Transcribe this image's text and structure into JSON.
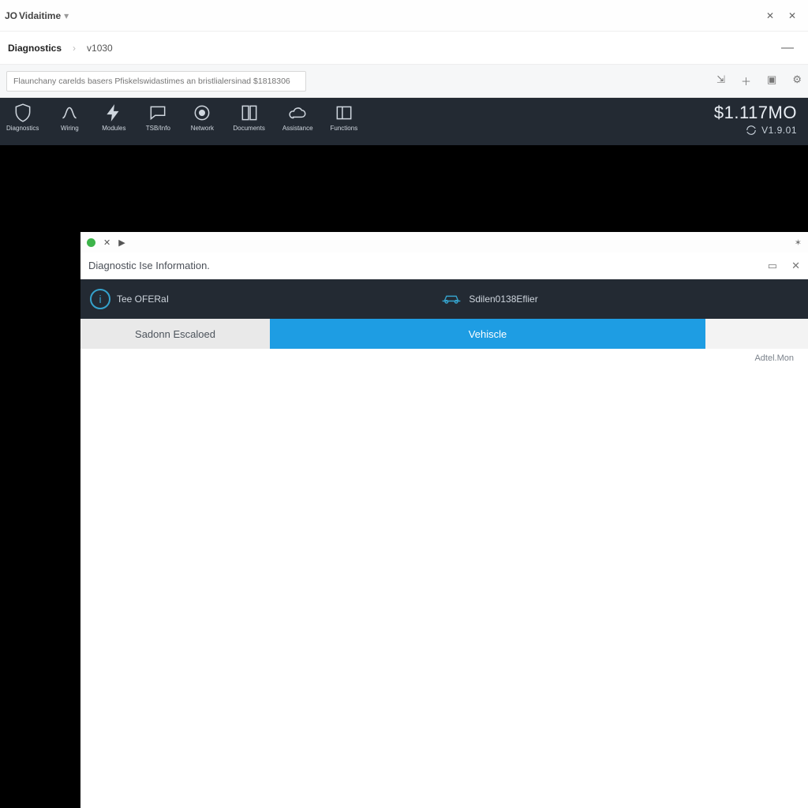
{
  "outer": {
    "window_title_prefix": "JO",
    "window_title": "Vidaitime",
    "breadcrumb": {
      "main": "Diagnostics",
      "sub": "v1030"
    },
    "search_placeholder": "Flaunchany carelds basers Pfiskelswidastimes an bristlialersinad $1818306",
    "winmin": "—",
    "winclose1": "✕",
    "winclose2": "✕"
  },
  "ribbon": {
    "items": [
      {
        "id": "diagnostics",
        "label": "Diagnostics",
        "icon": "shield"
      },
      {
        "id": "wiring",
        "label": "Wiring",
        "icon": "cable"
      },
      {
        "id": "modules",
        "label": "Modules",
        "icon": "bolt"
      },
      {
        "id": "tsb",
        "label": "TSB/Info",
        "icon": "chat-bubble"
      },
      {
        "id": "network",
        "label": "Network",
        "icon": "target"
      },
      {
        "id": "docs",
        "label": "Documents",
        "icon": "book"
      },
      {
        "id": "assist",
        "label": "Assistance",
        "icon": "cloud"
      },
      {
        "id": "functions",
        "label": "Functions",
        "icon": "panel"
      }
    ],
    "big_label": "$1.117MO",
    "version": "V1.9.01"
  },
  "inner": {
    "tabbar_close": "✕",
    "tabbar_run": "▶",
    "tabbar_star": "✶",
    "window_title": "Diagnostic Ise Information.",
    "min_btn": "▭",
    "close_btn": "✕",
    "path": {
      "seg1_label": "Tee OFERaI",
      "seg2_label": "Sdilen0138Eflier"
    },
    "tabs": {
      "tab1": "Sadonn Escaloed",
      "tab2": "Vehiscle"
    },
    "meta_label": "Adtel.Mon"
  }
}
